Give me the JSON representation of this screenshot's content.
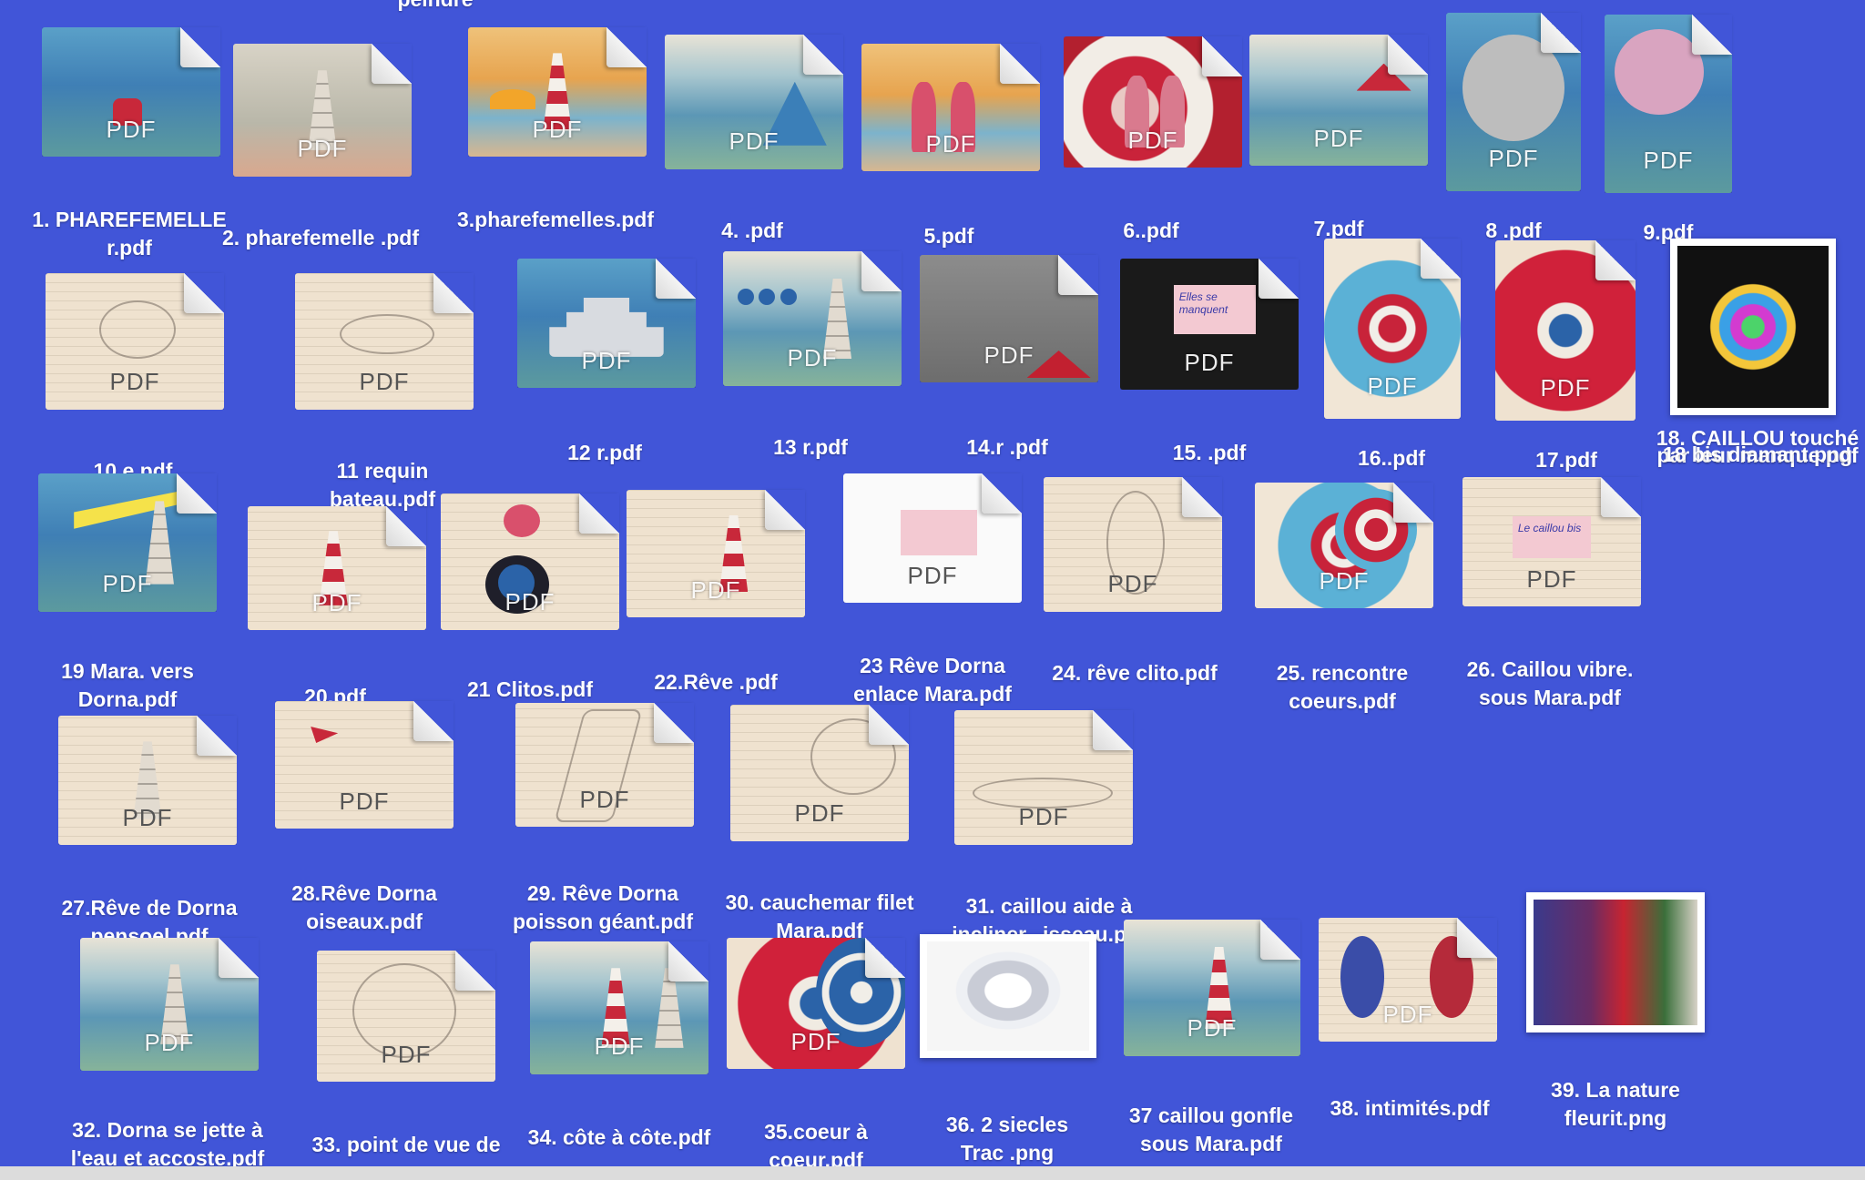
{
  "window": {
    "partial_top_label": "peindre"
  },
  "file_type_badge": "PDF",
  "files": [
    {
      "label": "1. PHAREFEMELLE r.pdf",
      "thumb": "sea",
      "kind": "pdf"
    },
    {
      "label": "2. pharefemelle .pdf",
      "thumb": "sand",
      "kind": "pdf"
    },
    {
      "label": "3.pharefemelles.pdf",
      "thumb": "warm",
      "kind": "pdf"
    },
    {
      "label": "4. .pdf",
      "thumb": "sea2",
      "kind": "pdf"
    },
    {
      "label": "5.pdf",
      "thumb": "warm",
      "kind": "pdf"
    },
    {
      "label": "6..pdf",
      "thumb": "red-ring",
      "kind": "pdf"
    },
    {
      "label": "7.pdf",
      "thumb": "sea2",
      "kind": "pdf"
    },
    {
      "label": "8 .pdf",
      "thumb": "sea",
      "kind": "pdf"
    },
    {
      "label": "9.pdf",
      "thumb": "sea",
      "kind": "pdf"
    },
    {
      "label": "10 e.pdf",
      "thumb": "paper-lines",
      "kind": "pdf"
    },
    {
      "label": "11 requin bateau.pdf",
      "thumb": "paper-lines",
      "kind": "pdf"
    },
    {
      "label": "12 r.pdf",
      "thumb": "sea",
      "kind": "pdf"
    },
    {
      "label": "13 r.pdf",
      "thumb": "sea2",
      "kind": "pdf"
    },
    {
      "label": "14.r .pdf",
      "thumb": "grey",
      "kind": "pdf"
    },
    {
      "label": "15. .pdf",
      "thumb": "black",
      "kind": "pdf"
    },
    {
      "label": "16..pdf",
      "thumb": "blue-spiral",
      "kind": "pdf"
    },
    {
      "label": "17.pdf",
      "thumb": "red-spiral",
      "kind": "pdf"
    },
    {
      "label": "18. CAILLOU touché par leur manque.pdf",
      "thumb": "diamond-dark",
      "kind": "png"
    },
    {
      "label": "18 bis diamant.png",
      "thumb": "none",
      "kind": "label-only"
    },
    {
      "label": "19 Mara. vers Dorna.pdf",
      "thumb": "sea",
      "kind": "pdf"
    },
    {
      "label": "20.pdf",
      "thumb": "paper-lines",
      "kind": "pdf"
    },
    {
      "label": "21 Clitos.pdf",
      "thumb": "paper-lines",
      "kind": "pdf"
    },
    {
      "label": "22.Rêve .pdf",
      "thumb": "paper-lines",
      "kind": "pdf"
    },
    {
      "label": "23 Rêve Dorna enlace Mara.pdf",
      "thumb": "white",
      "kind": "pdf"
    },
    {
      "label": "24. rêve clito.pdf",
      "thumb": "paper-lines",
      "kind": "pdf"
    },
    {
      "label": "25. rencontre coeurs.pdf",
      "thumb": "blue-spiral",
      "kind": "pdf"
    },
    {
      "label": "26. Caillou vibre. sous Mara.pdf",
      "thumb": "paper-lines",
      "kind": "pdf"
    },
    {
      "label": "27.Rêve de Dorna pensoel.pdf",
      "thumb": "paper-lines",
      "kind": "pdf"
    },
    {
      "label": "28.Rêve Dorna oiseaux.pdf",
      "thumb": "paper-lines",
      "kind": "pdf"
    },
    {
      "label": "29. Rêve Dorna poisson géant.pdf",
      "thumb": "paper-lines",
      "kind": "pdf"
    },
    {
      "label": "30. cauchemar filet Mara.pdf",
      "thumb": "paper-lines",
      "kind": "pdf"
    },
    {
      "label": "31. caillou aide à incliner...isseau.pdf",
      "thumb": "paper-lines",
      "kind": "pdf"
    },
    {
      "label": "32. Dorna se jette à l'eau et accoste.pdf",
      "thumb": "sea2",
      "kind": "pdf"
    },
    {
      "label": "33. point de vue de ...",
      "thumb": "paper-lines",
      "kind": "pdf"
    },
    {
      "label": "34. côte à côte.pdf",
      "thumb": "sea2",
      "kind": "pdf"
    },
    {
      "label": "35.coeur à coeur.pdf",
      "thumb": "red-spiral",
      "kind": "pdf"
    },
    {
      "label": "36. 2 siecles Trac .png",
      "thumb": "diamond-light",
      "kind": "png"
    },
    {
      "label": "37 caillou gonfle sous Mara.pdf",
      "thumb": "sea2",
      "kind": "pdf"
    },
    {
      "label": "38. intimités.pdf",
      "thumb": "paper-lines",
      "kind": "pdf"
    },
    {
      "label": "39. La nature fleurit.png",
      "thumb": "nature",
      "kind": "png"
    }
  ],
  "labels": {
    "l1": "1. PHAREFEMELLE r.pdf",
    "l2": "2. pharefemelle .pdf",
    "l3": "3.pharefemelles.pdf",
    "l4": "4. .pdf",
    "l5": "5.pdf",
    "l6": "6..pdf",
    "l7": "7.pdf",
    "l8": "8 .pdf",
    "l9": "9.pdf",
    "l10": "10 e.pdf",
    "l11": "11 requin bateau.pdf",
    "l12": "12 r.pdf",
    "l13": "13 r.pdf",
    "l14": "14.r .pdf",
    "l15": "15. .pdf",
    "l16": "16..pdf",
    "l17": "17.pdf",
    "l18": "18. CAILLOU touché par leur manque.pdf",
    "l18b": "18 bis diamant.png",
    "l19": "19 Mara. vers Dorna.pdf",
    "l20": "20.pdf",
    "l21": "21 Clitos.pdf",
    "l22": "22.Rêve .pdf",
    "l23": "23 Rêve Dorna enlace Mara.pdf",
    "l24": "24. rêve clito.pdf",
    "l25": "25. rencontre coeurs.pdf",
    "l26": "26. Caillou vibre. sous Mara.pdf",
    "l27": "27.Rêve de Dorna pensoel.pdf",
    "l28": "28.Rêve Dorna oiseaux.pdf",
    "l29": "29. Rêve Dorna poisson géant.pdf",
    "l30": "30. cauchemar filet Mara.pdf",
    "l31": "31. caillou aide à incliner...isseau.pdf",
    "l32": "32. Dorna se jette à l'eau et accoste.pdf",
    "l33": "33. point de vue de",
    "l34": "34. côte à côte.pdf",
    "l35": "35.coeur à coeur.pdf",
    "l36": "36. 2 siecles Trac .png",
    "l37": "37 caillou gonfle sous Mara.pdf",
    "l38": "38. intimités.pdf",
    "l39": "39. La nature fleurit.png"
  },
  "notes": {
    "n15": "Elles se manquent",
    "n26": "Le caillou bis"
  }
}
